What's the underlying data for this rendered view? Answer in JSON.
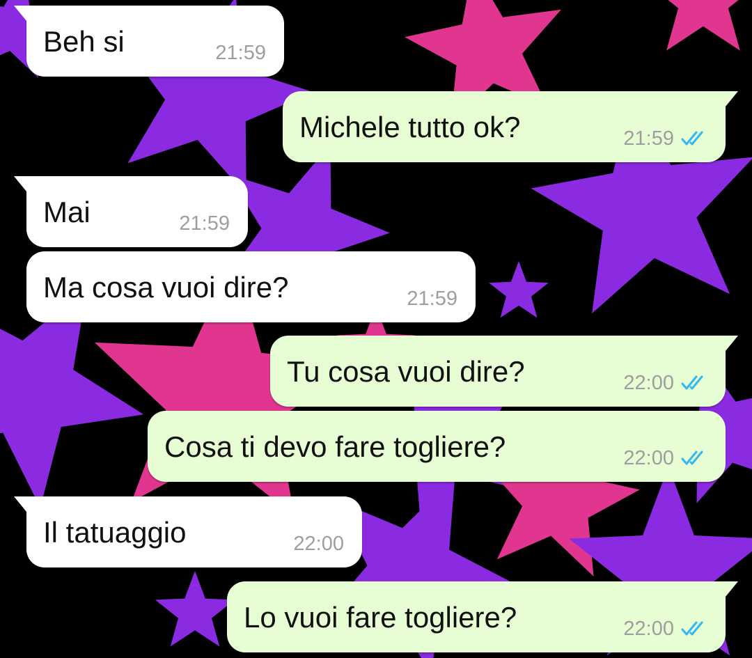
{
  "colors": {
    "incoming_bubble": "#ffffff",
    "outgoing_bubble": "#e7fdd3",
    "timestamp": "#9e9e9e",
    "read_ticks": "#34b7f1",
    "wallpaper_background": "#000000",
    "wallpaper_star_pink": "#e0368f",
    "wallpaper_star_purple": "#8a2be2"
  },
  "messages": [
    {
      "direction": "incoming",
      "text": "Beh si",
      "time": "21:59",
      "status_icon": null
    },
    {
      "direction": "outgoing",
      "text": "Michele tutto ok?",
      "time": "21:59",
      "status_icon": "double-check-read-icon"
    },
    {
      "direction": "incoming",
      "text": "Mai",
      "time": "21:59",
      "status_icon": null
    },
    {
      "direction": "incoming",
      "text": "Ma cosa vuoi dire?",
      "time": "21:59",
      "status_icon": null
    },
    {
      "direction": "outgoing",
      "text": "Tu cosa vuoi dire?",
      "time": "22:00",
      "status_icon": "double-check-read-icon"
    },
    {
      "direction": "outgoing",
      "text": "Cosa ti devo fare togliere?",
      "time": "22:00",
      "status_icon": "double-check-read-icon"
    },
    {
      "direction": "incoming",
      "text": "Il tatuaggio",
      "time": "22:00",
      "status_icon": null
    },
    {
      "direction": "outgoing",
      "text": "Lo vuoi fare togliere?",
      "time": "22:00",
      "status_icon": "double-check-read-icon"
    }
  ]
}
